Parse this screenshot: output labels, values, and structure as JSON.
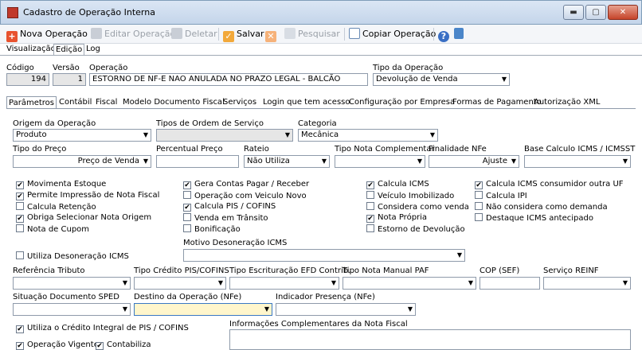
{
  "window": {
    "title": "Cadastro de Operação Interna",
    "btn_minimize": "▬",
    "btn_maximize": "▢",
    "btn_close": "✕"
  },
  "toolbar": {
    "nova": "Nova Operação",
    "editar": "Editar Operação",
    "deletar": "Deletar",
    "salvar": "Salvar",
    "pesquisar": "Pesquisar",
    "copiar": "Copiar Operação"
  },
  "view_tabs": [
    "Visualização",
    "Edição",
    "Log"
  ],
  "header": {
    "codigo_label": "Código",
    "codigo_value": "194",
    "versao_label": "Versão",
    "versao_value": "1",
    "operacao_label": "Operação",
    "operacao_value": "ESTORNO DE NF-E NAO ANULADA NO PRAZO LEGAL - BALCÃO",
    "tipo_label": "Tipo da Operação",
    "tipo_value": "Devolução de Venda"
  },
  "section_tabs": [
    "Parâmetros",
    "Contábil",
    "Fiscal",
    "Modelo Documento Fiscal",
    "Serviços",
    "Login que tem acesso",
    "Configuração por Empresa",
    "Formas de Pagamento",
    "Autorização XML"
  ],
  "form": {
    "origem_label": "Origem da Operação",
    "origem_value": "Produto",
    "tipos_os_label": "Tipos de Ordem de Serviço",
    "tipos_os_value": "",
    "categoria_label": "Categoria",
    "categoria_value": "Mecânica",
    "tipo_preco_label": "Tipo do Preço",
    "tipo_preco_value": "Preço de Venda",
    "perc_preco_label": "Percentual Preço",
    "perc_preco_value": "",
    "rateio_label": "Rateio",
    "rateio_value": "Não Utiliza",
    "tipo_nota_comp_label": "Tipo Nota Complementar",
    "tipo_nota_comp_value": "",
    "finalidade_label": "Finalidade NFe",
    "finalidade_value": "Ajuste",
    "base_calc_label": "Base Calculo ICMS / ICMSST",
    "base_calc_value": "",
    "motivo_deson_label": "Motivo Desoneração ICMS",
    "motivo_deson_value": "",
    "ref_tributo_label": "Referência Tributo",
    "tipo_cred_label": "Tipo Crédito PIS/COFINS",
    "tipo_escr_label": "Tipo Escrituração EFD Contrib.",
    "tipo_nota_manual_label": "Tipo Nota Manual PAF",
    "cop_label": "COP (SEF)",
    "servico_reinf_label": "Serviço REINF",
    "situacao_label": "Situação Documento SPED",
    "destino_label": "Destino da Operação (NFe)",
    "indicador_label": "Indicador Presença (NFe)",
    "info_compl_label": "Informações Complementares da Nota Fiscal"
  },
  "checkboxes": {
    "col1": [
      {
        "label": "Movimenta Estoque",
        "checked": true
      },
      {
        "label": "Permite Impressão de Nota Fiscal",
        "checked": true
      },
      {
        "label": "Calcula Retenção",
        "checked": false
      },
      {
        "label": "Obriga Selecionar Nota Origem",
        "checked": true
      },
      {
        "label": "Nota de Cupom",
        "checked": false
      }
    ],
    "col2": [
      {
        "label": "Gera Contas Pagar / Receber",
        "checked": true
      },
      {
        "label": "Operação com Veiculo Novo",
        "checked": false
      },
      {
        "label": "Calcula PIS / COFINS",
        "checked": true
      },
      {
        "label": "Venda em Trânsito",
        "checked": false
      },
      {
        "label": "Bonificação",
        "checked": false
      }
    ],
    "col3": [
      {
        "label": "Calcula ICMS",
        "checked": true
      },
      {
        "label": "Veículo Imobilizado",
        "checked": false
      },
      {
        "label": "Considera como venda",
        "checked": false
      },
      {
        "label": "Nota Própria",
        "checked": true
      },
      {
        "label": "Estorno de Devolução",
        "checked": false
      }
    ],
    "col4": [
      {
        "label": "Calcula ICMS consumidor outra UF",
        "checked": true
      },
      {
        "label": "Calcula IPI",
        "checked": false
      },
      {
        "label": "Não considera como demanda",
        "checked": false
      },
      {
        "label": "Destaque ICMS antecipado",
        "checked": false
      }
    ],
    "utiliza_deson": {
      "label": "Utiliza Desoneração ICMS",
      "checked": false
    },
    "credito_integral": {
      "label": "Utiliza o Crédito Integral de PIS / COFINS",
      "checked": true
    },
    "operacao_vigente": {
      "label": "Operação Vigente",
      "checked": true
    },
    "contabiliza": {
      "label": "Contabiliza",
      "checked": true
    }
  },
  "colors": {
    "accent_red": "#c0392b",
    "focus_field": "#fff6cc"
  }
}
